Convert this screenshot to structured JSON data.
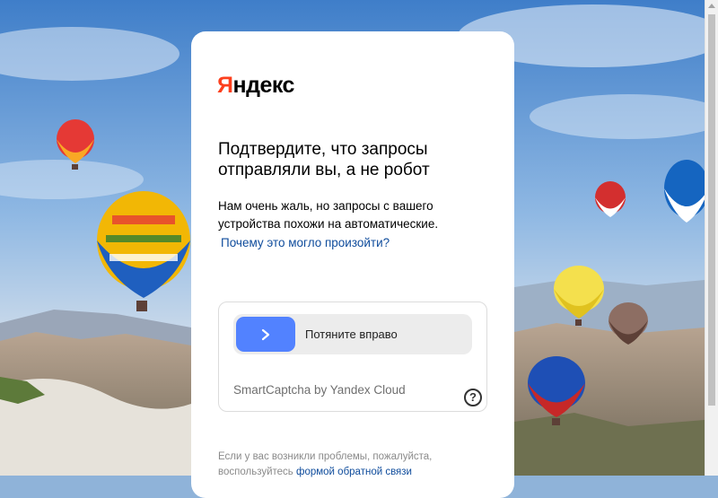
{
  "logo": {
    "first_letter": "Я",
    "rest": "ндекс"
  },
  "title": "Подтвердите, что запросы отправляли вы, а не робот",
  "description": "Нам очень жаль, но запросы с вашего устройства похожи на автоматические.",
  "why_link": "Почему это могло произойти?",
  "captcha": {
    "slider_label": "Потяните вправо",
    "brand": "SmartCaptcha by Yandex Cloud",
    "help_symbol": "?"
  },
  "footer": {
    "text": "Если у вас возникли проблемы, пожалуйста, воспользуйтесь",
    "link": "формой обратной связи"
  },
  "colors": {
    "brand_red": "#fc3f1d",
    "slider_blue": "#5282ff",
    "link_blue": "#0f4c9c"
  },
  "icons": [
    "chevron-right-icon",
    "help-circle-icon"
  ]
}
